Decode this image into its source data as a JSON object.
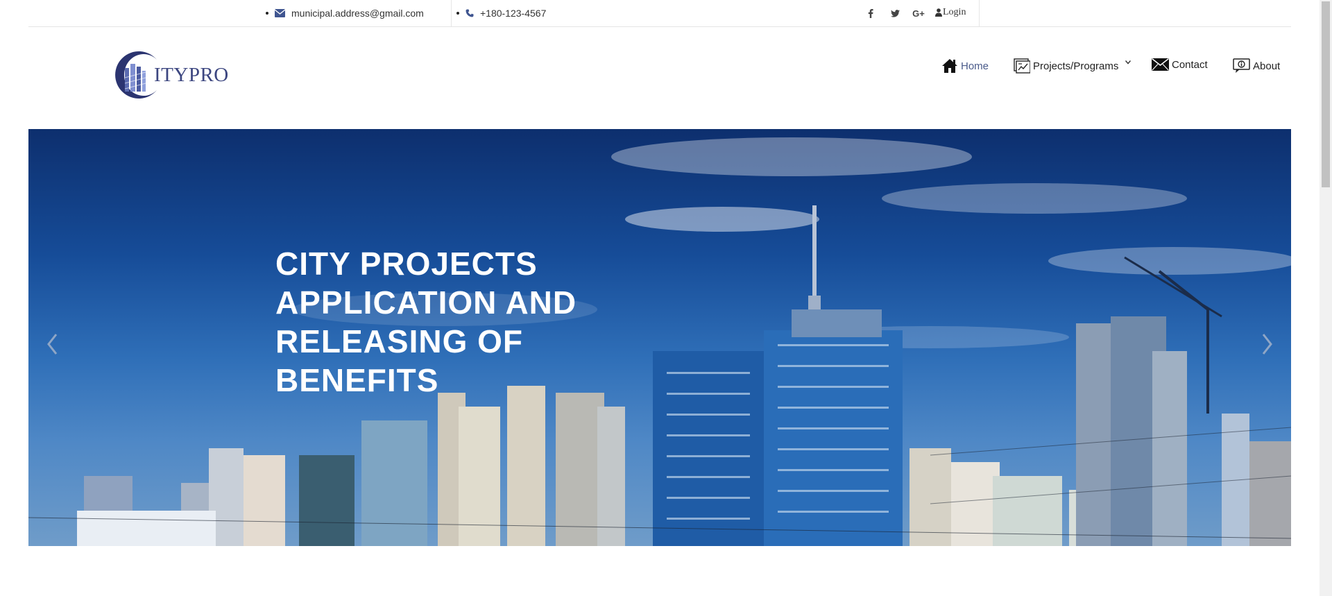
{
  "topbar": {
    "email": "municipal.address@gmail.com",
    "phone": "+180-123-4567",
    "social": [
      {
        "icon": "facebook-icon",
        "glyph": "f"
      },
      {
        "icon": "twitter-icon",
        "glyph": "t"
      },
      {
        "icon": "google-plus-icon",
        "glyph": "G+"
      }
    ],
    "login_label": "Login"
  },
  "header": {
    "logo_text": "ITYPRO",
    "nav": [
      {
        "label": "Home",
        "icon": "home-icon",
        "active": true
      },
      {
        "label": "Projects/Programs",
        "icon": "projects-icon",
        "has_dropdown": true
      },
      {
        "label": "Contact",
        "icon": "envelope-icon"
      },
      {
        "label": "About",
        "icon": "about-icon"
      }
    ]
  },
  "hero": {
    "title": "CITY PROJECTS APPLICATION AND RELEASING OF BENEFITS",
    "prev_icon": "chevron-left-icon",
    "next_icon": "chevron-right-icon"
  },
  "colors": {
    "brand": "#3c4680",
    "nav_active": "#4a5a8a",
    "hero_sky": "#164c98"
  }
}
